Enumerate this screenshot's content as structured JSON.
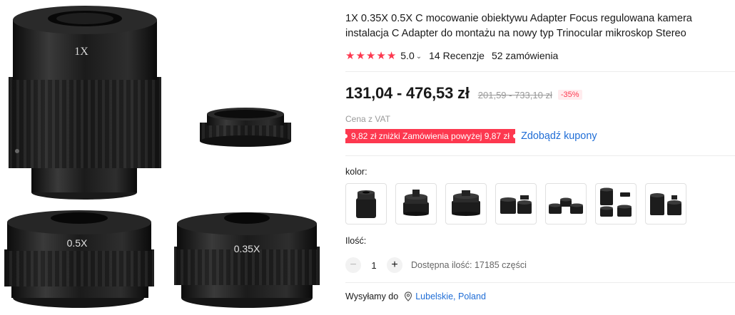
{
  "product": {
    "image_labels": {
      "lens_1x": "1X",
      "lens_05x": "0.5X",
      "lens_035x": "0.35X"
    },
    "title": "1X 0.35X 0.5X C mocowanie obiektywu Adapter Focus regulowana kamera instalacja C Adapter do montażu na nowy typ Trinocular mikroskop Stereo",
    "rating": {
      "stars_filled": 5,
      "value": "5.0",
      "reviews": "14 Recenzje",
      "orders": "52 zamówienia"
    },
    "price": {
      "current": "131,04 - 476,53 zł",
      "original": "201,59 - 733,10 zł",
      "discount": "-35%"
    },
    "vat_note": "Cena z VAT",
    "coupon": {
      "badge": "9,82 zł zniżki Zamówienia powyżej 9,87 zł",
      "link": "Zdobądź kupony"
    },
    "color": {
      "label": "kolor:",
      "swatch_count": 7
    },
    "quantity": {
      "label": "Ilość:",
      "minus": "−",
      "value": "1",
      "plus": "+",
      "stock": "Dostępna ilość: 17185 części"
    },
    "shipping": {
      "prefix": "Wysyłamy do",
      "location": "Lubelskie, Poland"
    }
  },
  "colors": {
    "accent": "#fd384f",
    "link": "#1f6dd6",
    "text": "#191919",
    "muted": "#999999"
  }
}
